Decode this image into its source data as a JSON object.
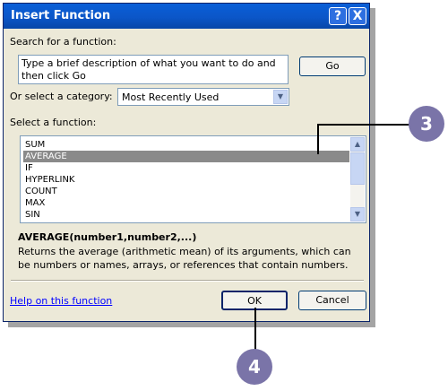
{
  "dialog": {
    "title": "Insert Function",
    "help_button": "?",
    "close_button": "X"
  },
  "search": {
    "label": "Search for a function:",
    "text": "Type a brief description of what you want to do and then click Go",
    "go_label": "Go"
  },
  "category": {
    "label": "Or select a category:",
    "selected": "Most Recently Used"
  },
  "functions": {
    "label": "Select a function:",
    "items": [
      "SUM",
      "AVERAGE",
      "IF",
      "HYPERLINK",
      "COUNT",
      "MAX",
      "SIN"
    ],
    "selected": "AVERAGE"
  },
  "details": {
    "syntax": "AVERAGE(number1,number2,...)",
    "description": "Returns the average (arithmetic mean) of its arguments, which can be numbers or names, arrays, or references that contain numbers."
  },
  "footer": {
    "help_link": "Help on this function",
    "ok_label": "OK",
    "cancel_label": "Cancel"
  },
  "callouts": [
    "3",
    "4"
  ]
}
